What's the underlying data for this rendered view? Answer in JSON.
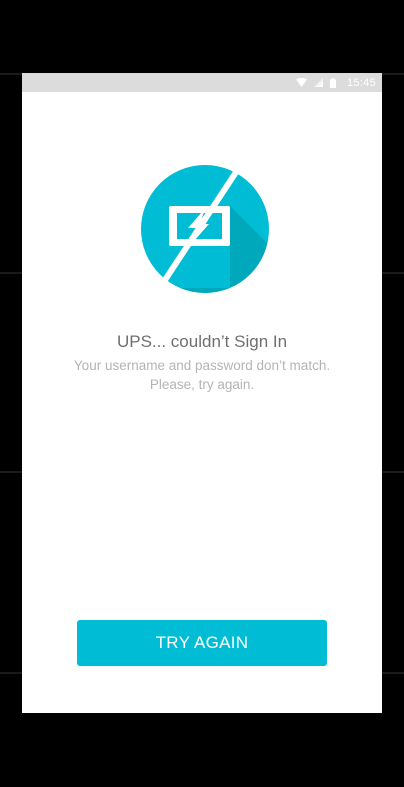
{
  "status_bar": {
    "time": "15:45",
    "icons": [
      "wifi-icon",
      "signal-icon",
      "battery-icon"
    ]
  },
  "error": {
    "icon": "no-charge-icon",
    "title": "UPS... couldn’t Sign In",
    "message_line1": "Your username and password don’t match.",
    "message_line2": "Please, try again."
  },
  "actions": {
    "try_again_label": "TRY AGAIN"
  },
  "colors": {
    "accent": "#00bcd4",
    "accent_dark": "#0097a7",
    "status_bar": "#dcdcdc",
    "title_text": "#6f6f6f",
    "body_text": "#b4b4b4"
  }
}
